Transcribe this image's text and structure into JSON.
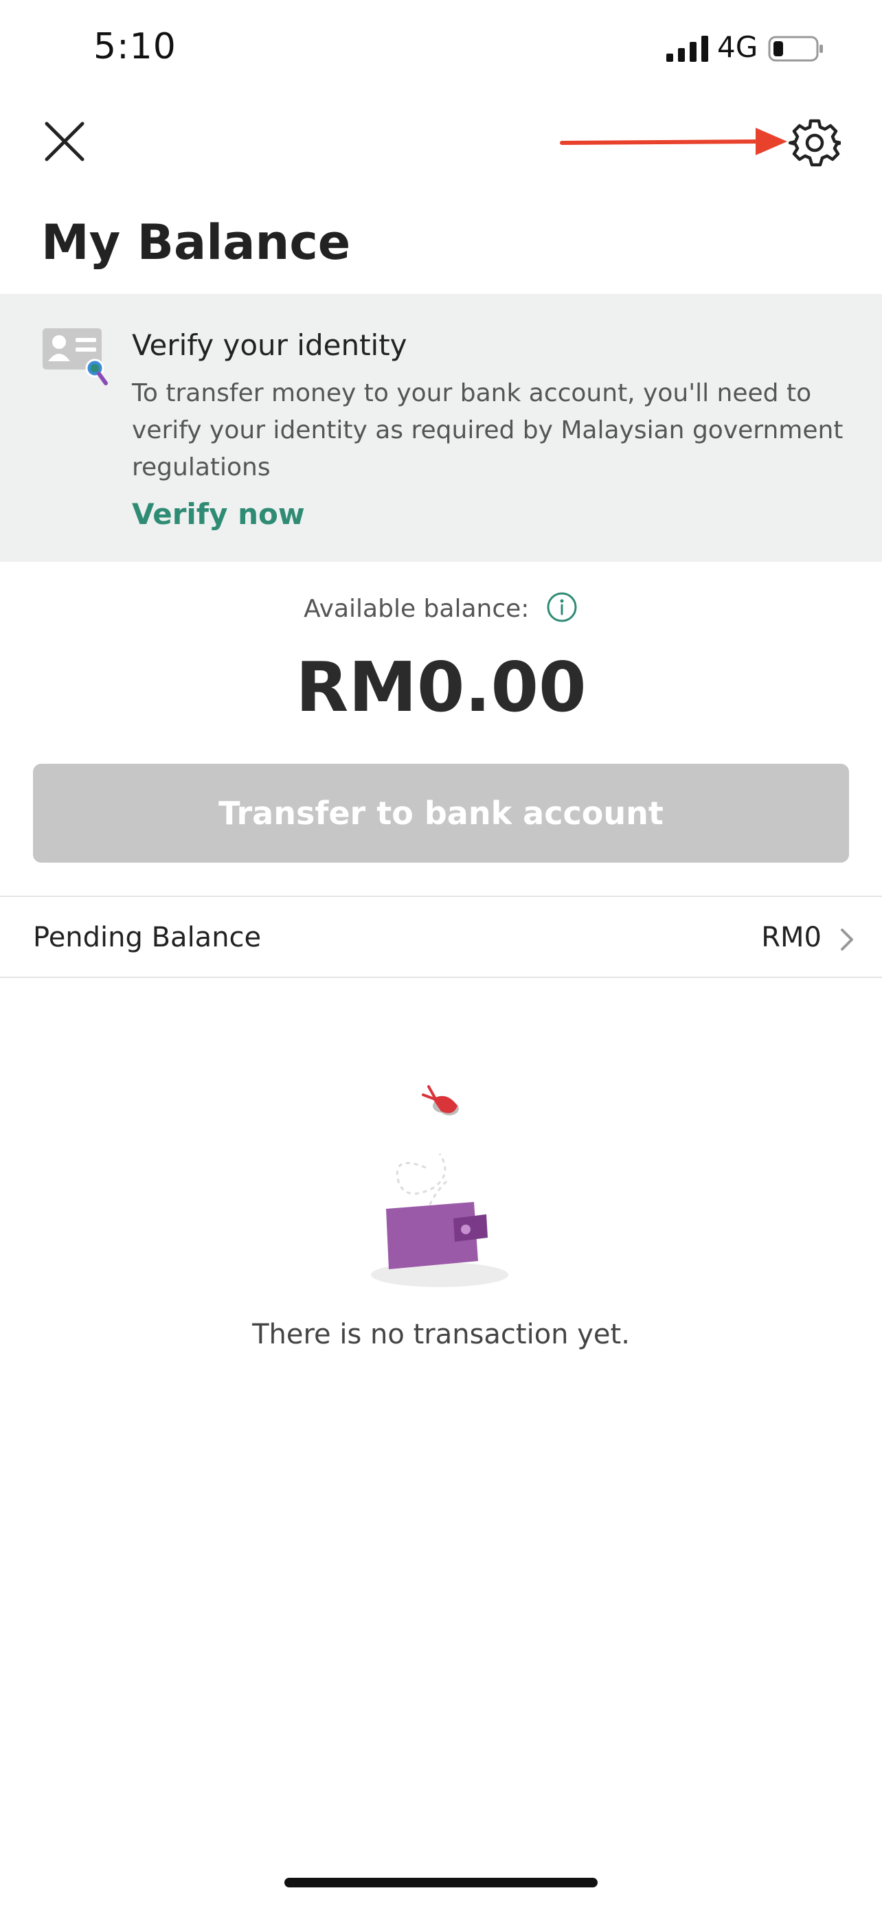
{
  "status_bar": {
    "time": "5:10",
    "network": "4G"
  },
  "nav": {
    "close_icon": "close-icon",
    "settings_icon": "gear-icon",
    "annotation_color": "#e8412c"
  },
  "page": {
    "title": "My Balance"
  },
  "verify": {
    "title": "Verify your identity",
    "description": "To transfer money to your bank account, you'll need to verify your identity as required by Malaysian government regulations",
    "link": "Verify now",
    "icon": "id-card-icon",
    "link_color": "#2e8b74"
  },
  "balance": {
    "label": "Available balance:",
    "amount": "RM0.00",
    "transfer_label": "Transfer to bank account"
  },
  "pending": {
    "label": "Pending Balance",
    "value": "RM0"
  },
  "empty": {
    "message": "There is no transaction yet."
  }
}
